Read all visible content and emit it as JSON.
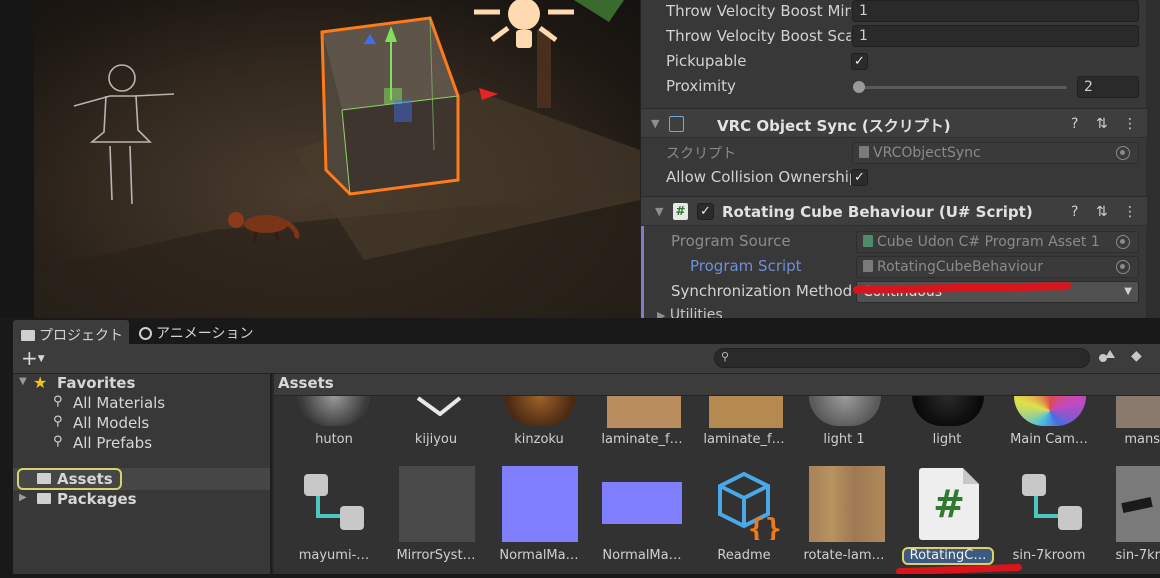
{
  "inspector": {
    "throw_velocity_boost_min": {
      "label": "Throw Velocity Boost Min",
      "value": "1"
    },
    "throw_velocity_boost_scale": {
      "label": "Throw Velocity Boost Sca",
      "value": "1"
    },
    "pickupable": {
      "label": "Pickupable",
      "checked": true
    },
    "proximity": {
      "label": "Proximity",
      "value": "2",
      "slider_fraction": 0.0
    },
    "object_sync": {
      "title": "VRC Object Sync (スクリプト)",
      "script_label": "スクリプト",
      "script_value": "VRCObjectSync",
      "allow_collision_label": "Allow Collision Ownership",
      "allow_collision_checked": true
    },
    "rotating_cube": {
      "title": "Rotating Cube Behaviour (U# Script)",
      "enabled": true,
      "program_source_label": "Program Source",
      "program_source_value": "Cube Udon C# Program Asset 1",
      "program_script_label": "Program Script",
      "program_script_value": "RotatingCubeBehaviour",
      "sync_method_label": "Synchronization Method",
      "sync_method_value": "Continuous",
      "utilities_label": "Utilities"
    },
    "header_icons": [
      "help-icon",
      "presets-icon",
      "kebab-menu-icon"
    ],
    "check_glyph": "✓"
  },
  "project": {
    "tabs": [
      {
        "label": "プロジェクト",
        "icon": "folder-icon",
        "active": true
      },
      {
        "label": "アニメーション",
        "icon": "clock-icon",
        "active": false
      }
    ],
    "add_button": "+",
    "tree": {
      "favorites_label": "Favorites",
      "favorites_items": [
        "All Materials",
        "All Models",
        "All Prefabs"
      ],
      "assets_label": "Assets",
      "packages_label": "Packages"
    },
    "grid_header": "Assets",
    "assets_row1": [
      "huton",
      "kijiyou",
      "kinzoku",
      "laminate_f…",
      "laminate_f…",
      "light 1",
      "light",
      "Main Cam…",
      "mans"
    ],
    "assets_row2": [
      "mayumi-…",
      "MirrorSyst…",
      "NormalMa…",
      "NormalMa…",
      "Readme",
      "rotate-lam…",
      "RotatingC…",
      "sin-7kroom",
      "sin-7kr"
    ],
    "hash_glyph": "#"
  },
  "colors": {
    "selection_outline": "#ff7a1a",
    "annotation_red": "#d8141c",
    "highlight_box": "#d9d26a",
    "program_script_text": "#6f8fd6",
    "normal_map": "#7f7fff"
  }
}
